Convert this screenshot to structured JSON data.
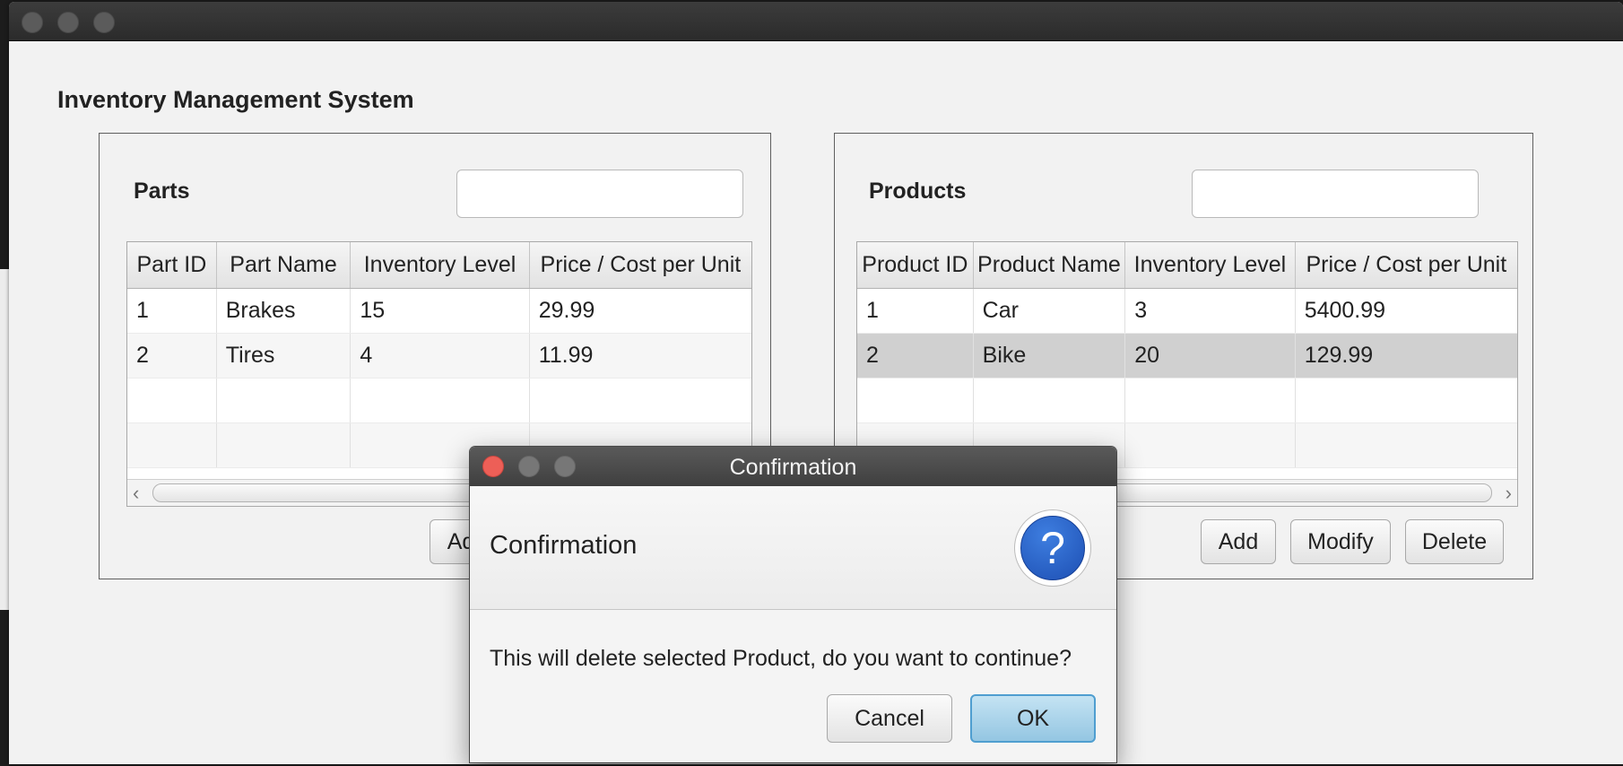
{
  "app": {
    "title": "Inventory Management System"
  },
  "parts": {
    "title": "Parts",
    "search_value": "",
    "columns": [
      "Part ID",
      "Part Name",
      "Inventory Level",
      "Price / Cost per Unit"
    ],
    "rows": [
      [
        "1",
        "Brakes",
        "15",
        "29.99"
      ],
      [
        "2",
        "Tires",
        "4",
        "11.99"
      ]
    ],
    "add_label": "Add"
  },
  "products": {
    "title": "Products",
    "search_value": "",
    "columns": [
      "Product ID",
      "Product Name",
      "Inventory Level",
      "Price / Cost per Unit"
    ],
    "rows": [
      [
        "1",
        "Car",
        "3",
        "5400.99"
      ],
      [
        "2",
        "Bike",
        "20",
        "129.99"
      ]
    ],
    "selected_row": 2,
    "add_label": "Add",
    "modify_label": "Modify",
    "delete_label": "Delete"
  },
  "dialog": {
    "window_title": "Confirmation",
    "header": "Confirmation",
    "icon_glyph": "?",
    "message": "This will delete selected Product, do you want to continue?",
    "cancel_label": "Cancel",
    "ok_label": "OK"
  },
  "colors": {
    "close_red": "#ed5f57",
    "ok_blue": "#a9d4ea",
    "question_blue": "#2a62cc"
  }
}
